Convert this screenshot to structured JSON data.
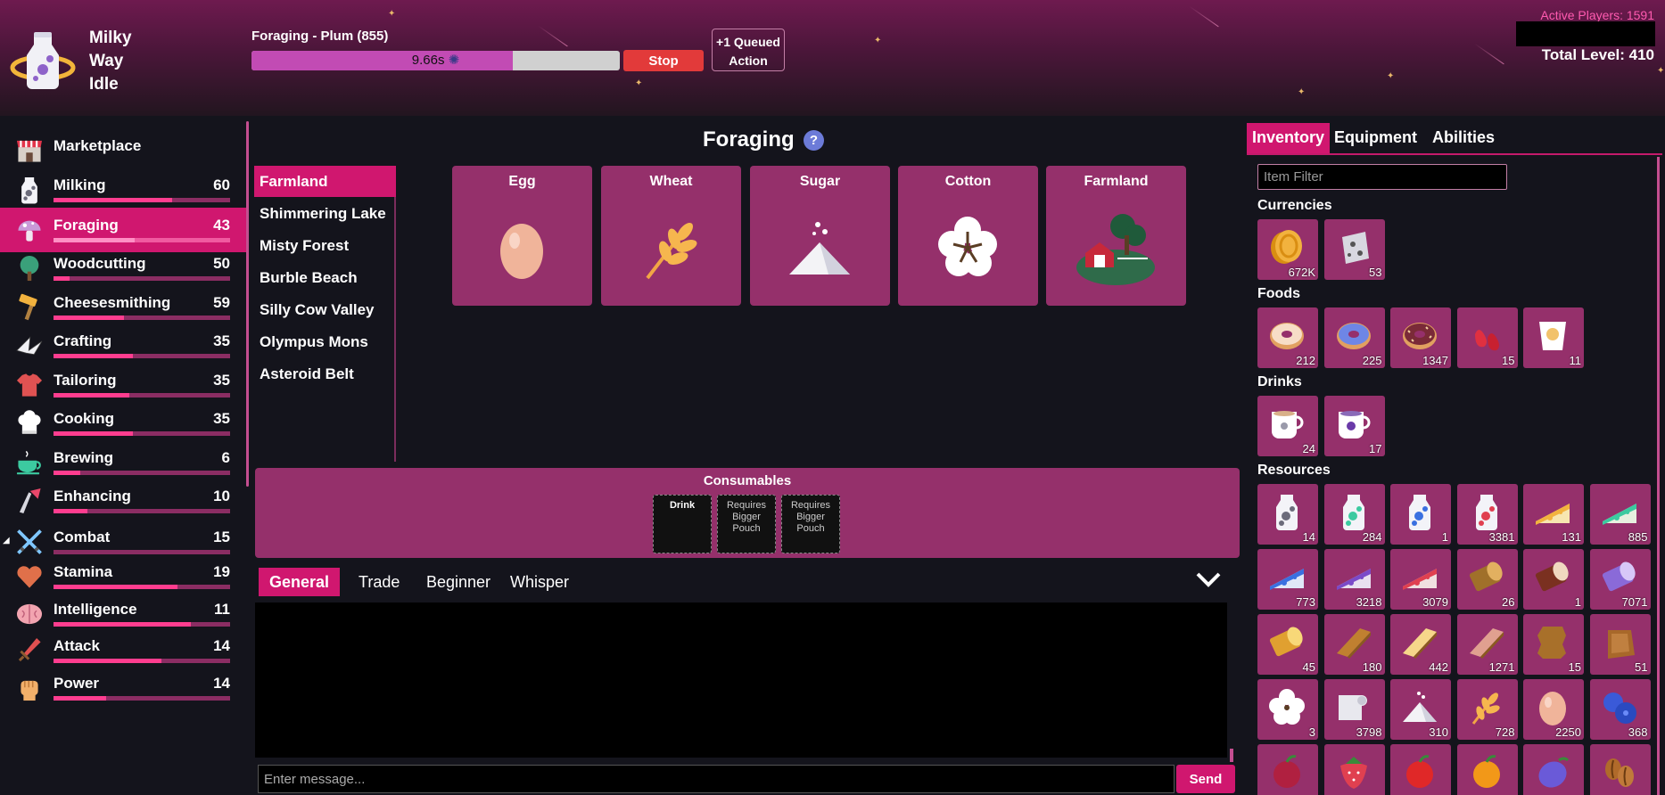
{
  "app": {
    "name": "Milky Way Idle"
  },
  "header": {
    "action_title": "Foraging - Plum (855)",
    "progress_text": "9.66s",
    "progress_fraction": 0.71,
    "stop_label": "Stop",
    "queue_label": "+1 Queued Action",
    "active_players": "Active Players: 1591",
    "total_level": "Total Level: 410"
  },
  "sidebar": {
    "items": [
      {
        "label": "Marketplace",
        "level": "",
        "progress": 0,
        "icon": "marketplace-icon"
      },
      {
        "label": "Milking",
        "level": "60",
        "progress": 0.67,
        "icon": "milk-bottle-icon"
      },
      {
        "label": "Foraging",
        "level": "43",
        "progress": 0.46,
        "icon": "mushroom-icon",
        "active": true
      },
      {
        "label": "Woodcutting",
        "level": "50",
        "progress": 0.09,
        "icon": "tree-icon"
      },
      {
        "label": "Cheesesmithing",
        "level": "59",
        "progress": 0.4,
        "icon": "hammer-icon"
      },
      {
        "label": "Crafting",
        "level": "35",
        "progress": 0.45,
        "icon": "crane-icon"
      },
      {
        "label": "Tailoring",
        "level": "35",
        "progress": 0.43,
        "icon": "shirt-icon"
      },
      {
        "label": "Cooking",
        "level": "35",
        "progress": 0.45,
        "icon": "chef-hat-icon"
      },
      {
        "label": "Brewing",
        "level": "6",
        "progress": 0.15,
        "icon": "teacup-icon"
      },
      {
        "label": "Enhancing",
        "level": "10",
        "progress": 0.19,
        "icon": "enhancing-icon"
      },
      {
        "label": "Combat",
        "level": "15",
        "progress": 0,
        "icon": "crossed-swords-icon"
      },
      {
        "label": "Stamina",
        "level": "19",
        "progress": 0.7,
        "icon": "heart-icon"
      },
      {
        "label": "Intelligence",
        "level": "11",
        "progress": 0.78,
        "icon": "brain-icon"
      },
      {
        "label": "Attack",
        "level": "14",
        "progress": 0.61,
        "icon": "dagger-icon"
      },
      {
        "label": "Power",
        "level": "14",
        "progress": 0.3,
        "icon": "fist-icon"
      }
    ]
  },
  "main": {
    "title": "Foraging",
    "help": "?",
    "zones": [
      "Farmland",
      "Shimmering Lake",
      "Misty Forest",
      "Burble Beach",
      "Silly Cow Valley",
      "Olympus Mons",
      "Asteroid Belt"
    ],
    "tiles": [
      "Egg",
      "Wheat",
      "Sugar",
      "Cotton",
      "Farmland"
    ],
    "consumables": {
      "title": "Consumables",
      "slots": [
        "Drink",
        "Requires Bigger Pouch",
        "Requires Bigger Pouch"
      ]
    }
  },
  "chat": {
    "tabs": [
      "General",
      "Trade",
      "Beginner",
      "Whisper"
    ],
    "placeholder": "Enter message...",
    "send_label": "Send"
  },
  "inventory": {
    "tabs": [
      "Inventory",
      "Equipment",
      "Abilities"
    ],
    "filter_placeholder": "Item Filter",
    "categories": [
      {
        "title": "Currencies",
        "items": [
          {
            "icon": "gold-coin-icon",
            "count": "672K"
          },
          {
            "icon": "task-token-icon",
            "count": "53"
          }
        ]
      },
      {
        "title": "Foods",
        "items": [
          {
            "icon": "donut-icon",
            "count": "212"
          },
          {
            "icon": "blueberry-donut-icon",
            "count": "225"
          },
          {
            "icon": "chocolate-donut-icon",
            "count": "1347"
          },
          {
            "icon": "gummy-icon",
            "count": "15"
          },
          {
            "icon": "yogurt-icon",
            "count": "11"
          }
        ]
      },
      {
        "title": "Drinks",
        "items": [
          {
            "icon": "milk-tea-icon",
            "count": "24"
          },
          {
            "icon": "berry-tea-icon",
            "count": "17"
          }
        ]
      },
      {
        "title": "Resources",
        "items": [
          {
            "icon": "milk-icon",
            "count": "14"
          },
          {
            "icon": "verdant-milk-icon",
            "count": "284"
          },
          {
            "icon": "azure-milk-icon",
            "count": "1"
          },
          {
            "icon": "crimson-milk-icon",
            "count": "3381"
          },
          {
            "icon": "cheese-icon",
            "count": "131"
          },
          {
            "icon": "verdant-cheese-icon",
            "count": "885"
          },
          {
            "icon": "azure-cheese-icon",
            "count": "773"
          },
          {
            "icon": "purple-cheese-icon",
            "count": "3218"
          },
          {
            "icon": "crimson-cheese-icon",
            "count": "3079"
          },
          {
            "icon": "log-icon",
            "count": "26"
          },
          {
            "icon": "birch-log-icon",
            "count": "1"
          },
          {
            "icon": "purple-log-icon",
            "count": "7071"
          },
          {
            "icon": "yellow-log-icon",
            "count": "45"
          },
          {
            "icon": "lumber-icon",
            "count": "180"
          },
          {
            "icon": "light-lumber-icon",
            "count": "442"
          },
          {
            "icon": "bacon-lumber-icon",
            "count": "1271"
          },
          {
            "icon": "leather-icon",
            "count": "15"
          },
          {
            "icon": "hide-icon",
            "count": "51"
          },
          {
            "icon": "cotton-icon",
            "count": "3"
          },
          {
            "icon": "fabric-icon",
            "count": "3798"
          },
          {
            "icon": "sugar-icon",
            "count": "310"
          },
          {
            "icon": "wheat-icon",
            "count": "728"
          },
          {
            "icon": "egg-icon",
            "count": "2250"
          },
          {
            "icon": "blueberry-icon",
            "count": "368"
          },
          {
            "icon": "raspberry-icon",
            "count": ""
          },
          {
            "icon": "strawberry-icon",
            "count": ""
          },
          {
            "icon": "apple-icon",
            "count": ""
          },
          {
            "icon": "orange-icon",
            "count": ""
          },
          {
            "icon": "plum-icon",
            "count": ""
          },
          {
            "icon": "coffee-bean-icon",
            "count": ""
          }
        ]
      }
    ]
  },
  "colors": {
    "accent": "#d0176f",
    "tile": "#95306b",
    "stop": "#e23a3a",
    "active_players": "#ff5ab0"
  }
}
